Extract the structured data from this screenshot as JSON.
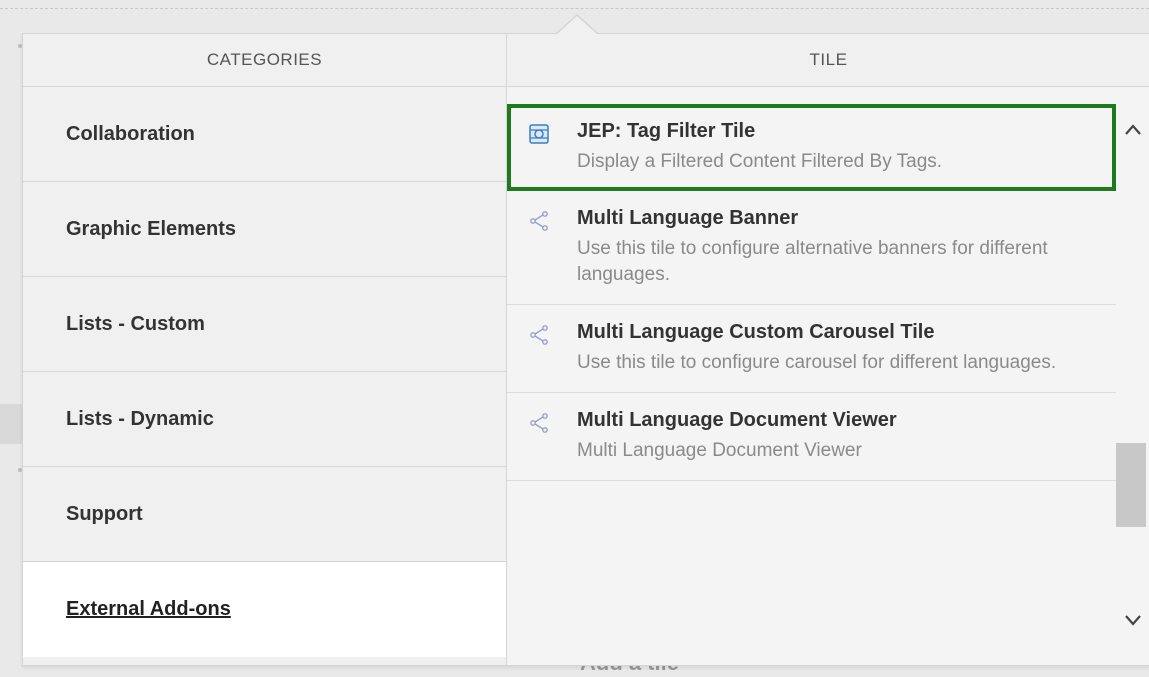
{
  "categories_header": "CATEGORIES",
  "tile_header": "TILE",
  "categories": [
    {
      "label": "Collaboration"
    },
    {
      "label": "Graphic Elements"
    },
    {
      "label": "Lists - Custom"
    },
    {
      "label": "Lists - Dynamic"
    },
    {
      "label": "Support"
    },
    {
      "label": "External Add-ons"
    }
  ],
  "selected_category": "External Add-ons",
  "tiles": [
    {
      "title": "JEP: Tag Filter Tile",
      "description": "Display a Filtered Content Filtered By Tags.",
      "icon": "tag-filter-icon"
    },
    {
      "title": "Multi Language Banner",
      "description": "Use this tile to configure alternative banners for different languages.",
      "icon": "share-icon"
    },
    {
      "title": "Multi Language Custom Carousel Tile",
      "description": "Use this tile to configure carousel for different languages.",
      "icon": "share-icon"
    },
    {
      "title": "Multi Language Document Viewer",
      "description": "Multi Language Document Viewer",
      "icon": "share-icon"
    }
  ],
  "background_text": "Add a tile",
  "colors": {
    "highlight_border": "#1e7a1e",
    "icon_blue": "#3a7fc1",
    "share_icon": "#9aa0c8"
  }
}
